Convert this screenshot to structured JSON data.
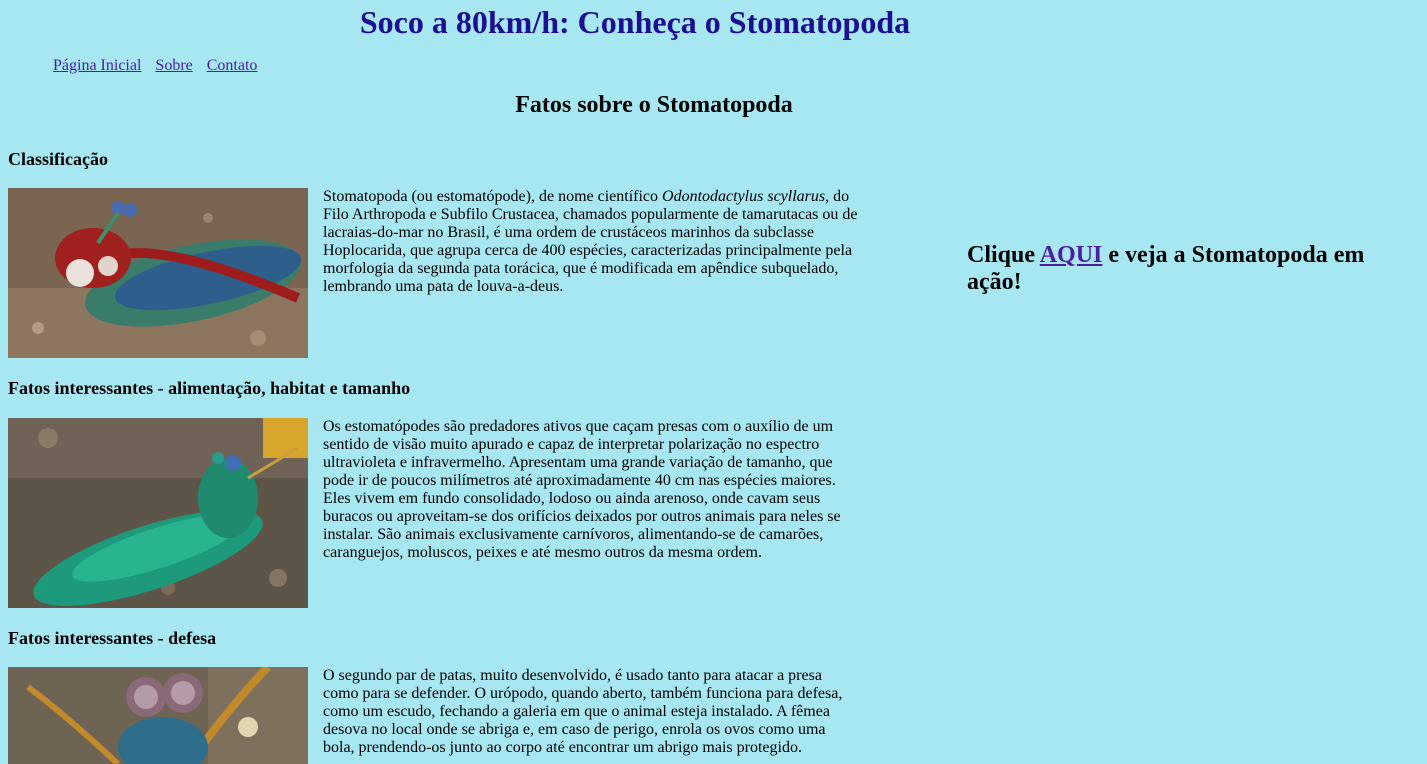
{
  "header": {
    "title": "Soco a 80km/h: Conheça o Stomatopoda"
  },
  "nav": {
    "items": [
      "Página Inicial",
      "Sobre",
      "Contato"
    ]
  },
  "main": {
    "title": "Fatos sobre o Stomatopoda",
    "sections": [
      {
        "heading": "Classificação",
        "text_before": "Stomatopoda (ou estomatópode), de nome científico ",
        "text_italic": "Odontodactylus scyllarus",
        "text_after": ", do Filo Arthropoda e Subfilo Crustacea, chamados popularmente de tamarutacas ou de lacraias-do-mar no Brasil, é uma ordem de crustáceos marinhos da subclasse Hoplocarida, que agrupa cerca de 400 espécies, caracterizadas principalmente pela morfologia da segunda pata torácica, que é modificada em apêndice subquelado, lembrando uma pata de louva-a-deus."
      },
      {
        "heading": "Fatos interessantes - alimentação, habitat e tamanho",
        "text": "Os estomatópodes são predadores ativos que caçam presas com o auxílio de um sentido de visão muito apurado e capaz de interpretar polarização no espectro ultravioleta e infravermelho. Apresentam uma grande variação de tamanho, que pode ir de poucos milímetros até aproximadamente 40 cm nas espécies maiores. Eles vivem em fundo consolidado, lodoso ou ainda arenoso, onde cavam seus buracos ou aproveitam-se dos orifícios deixados por outros animais para neles se instalar. São animais exclusivamente carnívoros, alimentando-se de camarões, caranguejos, moluscos, peixes e até mesmo outros da mesma ordem."
      },
      {
        "heading": "Fatos interessantes - defesa",
        "text": "O segundo par de patas, muito desenvolvido, é usado tanto para atacar a presa como para se defender. O urópodo, quando aberto, também funciona para defesa, como um escudo, fechando a galeria em que o animal esteja instalado. A fêmea desova no local onde se abriga e, em caso de perigo, enrola os ovos como uma bola, prendendo-os junto ao corpo até encontrar um abrigo mais protegido."
      }
    ]
  },
  "aside": {
    "prefix": "Clique ",
    "link": "AQUI",
    "suffix": " e veja a Stomatopoda em ação!"
  },
  "colors": {
    "background": "#a6e7f1",
    "title": "#1c0f94",
    "link": "#4b1ea0"
  }
}
